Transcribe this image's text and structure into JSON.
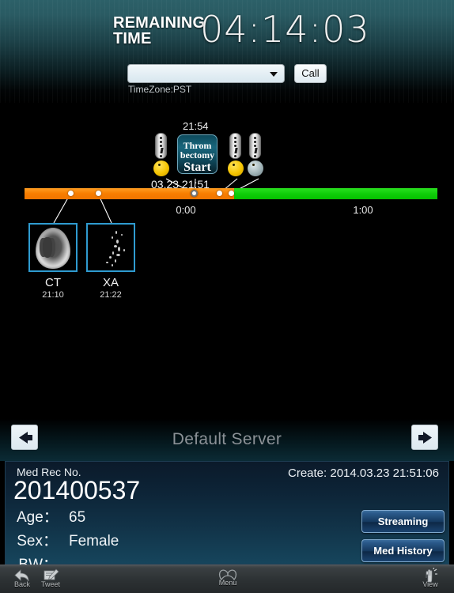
{
  "header": {
    "remaining_label_line1": "REMAINING",
    "remaining_label_line2": "TIME",
    "clock": "04:14:03",
    "server_select_value": "",
    "server_select_placeholder": "",
    "caret_icon": "chevron-down-icon",
    "call_button": "Call",
    "timezone": "TimeZone:PST"
  },
  "timeline": {
    "bar_colors": {
      "elapsed": "#f87e00",
      "remaining": "#12cc0c"
    },
    "tick_labels": [
      "0:00",
      "1:00"
    ],
    "event_time_top": "21:54",
    "event_date_label": "03.23 21:51",
    "event_box": {
      "line1": "Throm",
      "line2": "bectomy",
      "line3": "Start"
    },
    "markers": [
      {
        "name": "marker-alert-1",
        "icon": "thermometer-alert-icon",
        "face": "pac-yellow-icon"
      },
      {
        "name": "marker-alert-2",
        "icon": "thermometer-alert-icon",
        "face": "pac-yellow-icon"
      },
      {
        "name": "marker-alert-3",
        "icon": "thermometer-alert-icon",
        "face": "pac-grey-icon"
      }
    ],
    "studies": [
      {
        "modality": "CT",
        "time": "21:10",
        "thumb": "brain-ct-thumbnail"
      },
      {
        "modality": "XA",
        "time": "21:22",
        "thumb": "angiography-thumbnail"
      }
    ]
  },
  "server_bar": {
    "prev_icon": "arrow-left-icon",
    "next_icon": "arrow-right-icon",
    "name": "Default Server"
  },
  "patient": {
    "mrn_label": "Med Rec No.",
    "mrn_value": "201400537",
    "create": "Create: 2014.03.23 21:51:06",
    "fields": [
      {
        "key": "Age：",
        "value": "65"
      },
      {
        "key": "Sex：",
        "value": "Female"
      },
      {
        "key": "BW：",
        "value": ""
      }
    ],
    "streaming_button": "Streaming",
    "med_history_button": "Med History"
  },
  "toolbar": {
    "items": [
      {
        "label": "Back",
        "icon": "back-arrow-icon"
      },
      {
        "label": "Tweet",
        "icon": "compose-note-icon"
      },
      {
        "label": "Menu",
        "icon": "book-icon"
      },
      {
        "label": "View",
        "icon": "hand-touch-icon"
      }
    ]
  }
}
